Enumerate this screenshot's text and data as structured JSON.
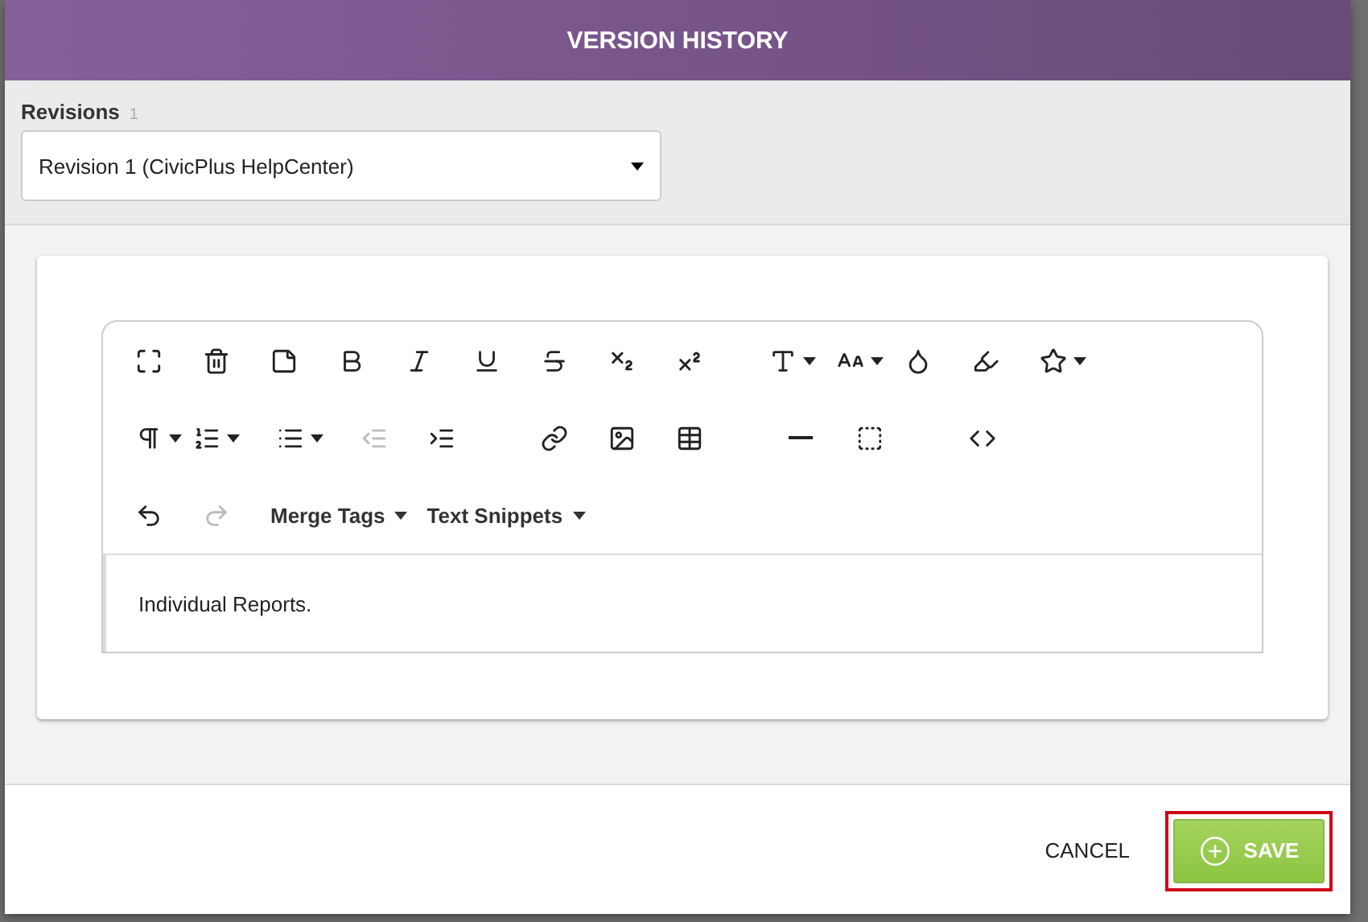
{
  "dialog": {
    "title": "VERSION HISTORY"
  },
  "revisions": {
    "label": "Revisions",
    "count": "1",
    "value": "Revision 1 (CivicPlus HelpCenter)"
  },
  "toolbar": {
    "buttons": [
      {
        "disabled": false
      },
      {
        "disabled": false
      },
      {
        "disabled": false
      },
      {
        "disabled": false
      },
      {
        "disabled": false
      },
      {
        "disabled": false
      },
      {
        "disabled": false
      },
      {
        "disabled": false
      },
      {
        "disabled": false
      },
      {
        "disabled": false
      },
      {
        "disabled": false
      },
      {
        "disabled": false
      },
      {
        "disabled": false
      },
      {
        "disabled": false
      },
      {
        "disabled": false
      },
      {
        "disabled": false
      },
      {
        "disabled": false
      },
      {
        "disabled": true
      },
      {
        "disabled": false
      },
      {
        "disabled": false
      },
      {
        "disabled": false
      },
      {
        "disabled": false
      },
      {
        "disabled": false
      },
      {
        "disabled": false
      },
      {
        "disabled": false
      },
      {
        "disabled": false
      },
      {
        "disabled": true
      }
    ],
    "menus": [
      {
        "label": "Merge Tags"
      },
      {
        "label": "Text Snippets"
      }
    ]
  },
  "editor": {
    "content": "Individual Reports."
  },
  "footer": {
    "cancel": "CANCEL",
    "save": "SAVE",
    "save_highlighted": true
  }
}
